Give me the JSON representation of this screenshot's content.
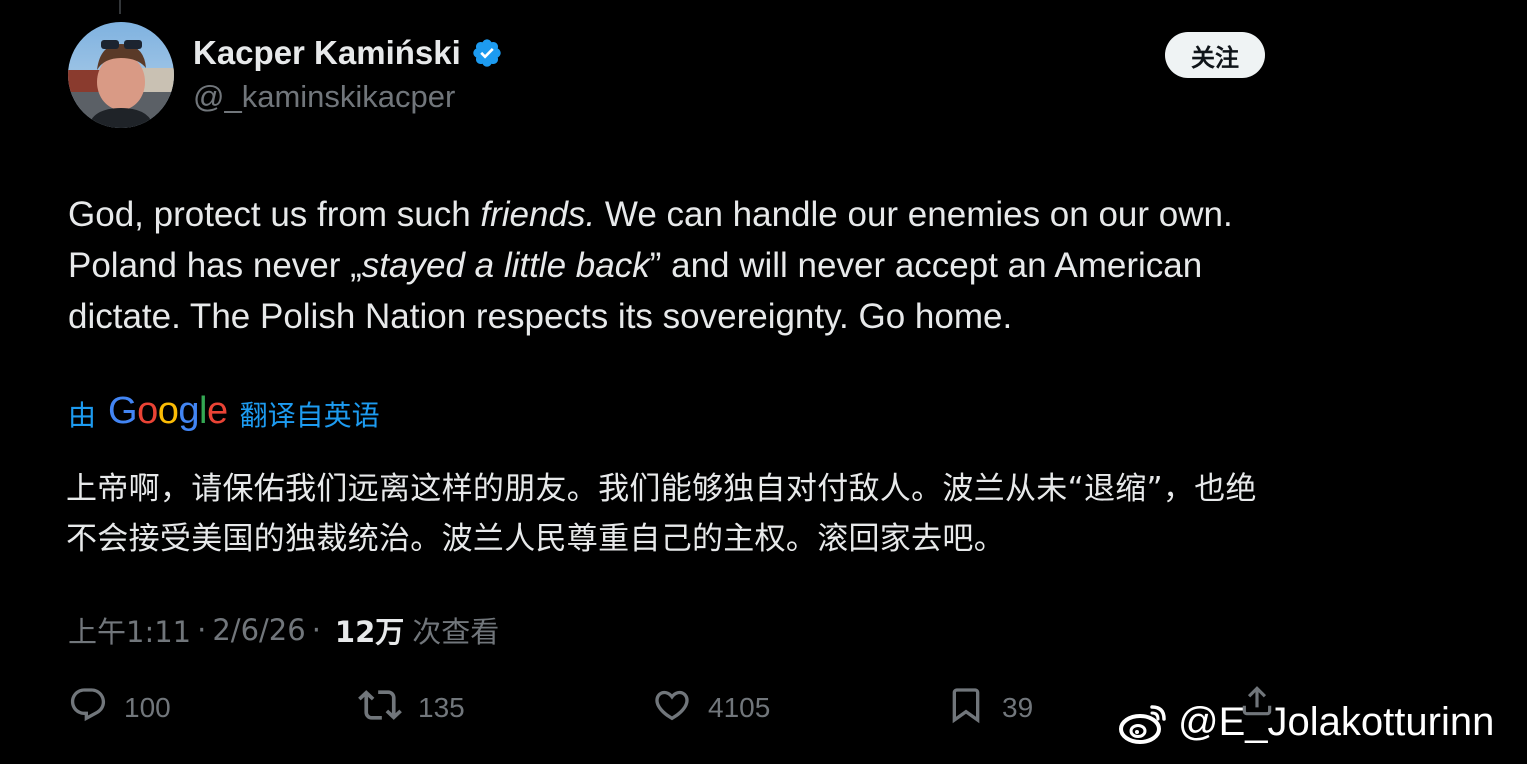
{
  "author": {
    "display_name": "Kacper Kamiński",
    "handle": "@_kaminskikacper",
    "verified_icon": "verified-badge-icon",
    "verified_color": "#1d9bf0"
  },
  "follow_label": "关注",
  "tweet": {
    "segments": [
      {
        "text": "God, protect us from such ",
        "italic": false
      },
      {
        "text": "friends.",
        "italic": true
      },
      {
        "text": " We can handle our enemies on our own. Poland has never „",
        "italic": false
      },
      {
        "text": "stayed a little back",
        "italic": true
      },
      {
        "text": "” and will never accept an American dictate. The Polish Nation respects its sovereignty. Go home.",
        "italic": false
      }
    ]
  },
  "translation": {
    "prefix": "由",
    "provider": "Google",
    "suffix": "翻译自英语",
    "text": "上帝啊，请保佑我们远离这样的朋友。我们能够独自对付敌人。波兰从未“退缩”，也绝不会接受美国的独裁统治。波兰人民尊重自己的主权。滚回家去吧。"
  },
  "meta": {
    "time": "上午1:11",
    "date": "2/6/26",
    "views": "12万",
    "views_label": "次查看",
    "separator": "·"
  },
  "actions": {
    "replies": "100",
    "retweets": "135",
    "likes": "4105",
    "bookmarks": "39"
  },
  "watermark": "@E_Jolakotturinn",
  "colors": {
    "background": "#000000",
    "text": "#e7e9ea",
    "secondary": "#71767b",
    "link": "#1d9bf0"
  }
}
